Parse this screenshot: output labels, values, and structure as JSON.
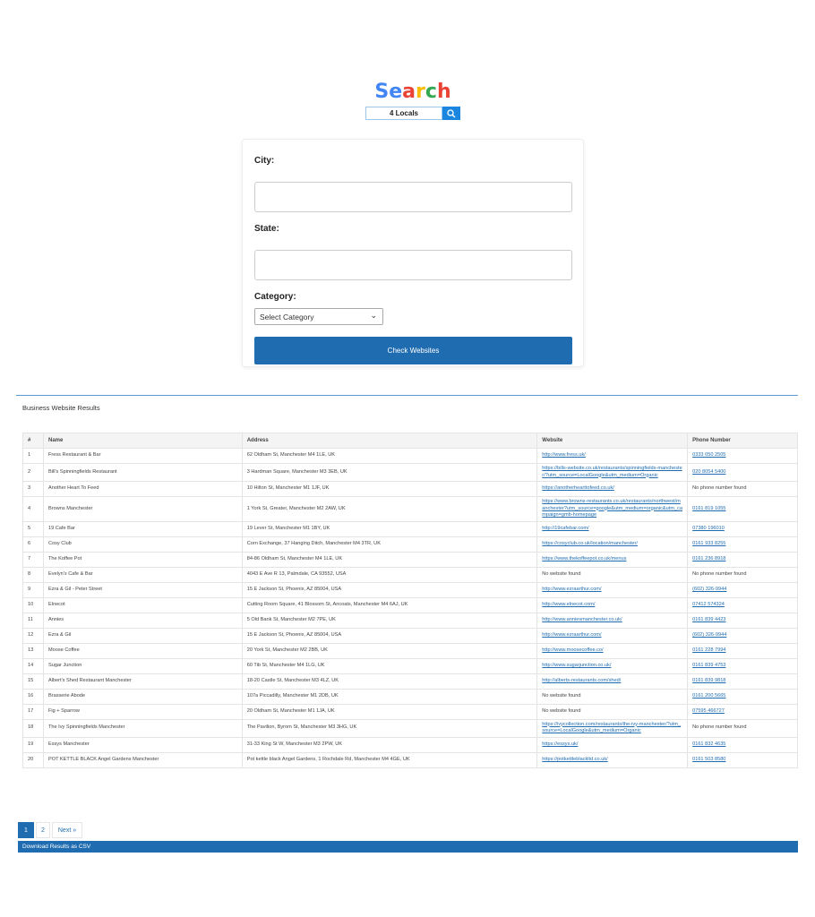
{
  "header": {
    "title_letters": [
      "S",
      "e",
      "a",
      "r",
      "c",
      "h"
    ],
    "title_colors": [
      "#4285f4",
      "#4285f4",
      "#ea4335",
      "#fbbc05",
      "#34a853",
      "#ea4335"
    ],
    "search_value": "4 Locals",
    "search_icon": "search-icon"
  },
  "form": {
    "city_label": "City:",
    "city_value": "",
    "state_label": "State:",
    "state_value": "",
    "category_label": "Category:",
    "category_selected": "Select Category",
    "submit_label": "Check Websites"
  },
  "results": {
    "title": "Business Website Results",
    "columns": [
      "#",
      "Name",
      "Address",
      "Website",
      "Phone Number"
    ],
    "rows": [
      [
        "1",
        "Fress Restaurant & Bar",
        "62 Oldham St, Manchester M4 1LE, UK",
        "http://www.fress.uk/",
        "0333 050 2505"
      ],
      [
        "2",
        "Bill's Spinningfields Restaurant",
        "3 Hardman Square, Manchester M3 3EB, UK",
        "https://bills-website.co.uk/restaurants/spinningfields-manchester/?utm_source=LocalGoogle&utm_medium=Organic",
        "020 8054 5400"
      ],
      [
        "3",
        "Another Heart To Feed",
        "10 Hilton St, Manchester M1 1JF, UK",
        "https://anotherhearttofeed.co.uk/",
        "No phone number found"
      ],
      [
        "4",
        "Browns Manchester",
        "1 York St, Greater, Manchester M2 2AW, UK",
        "https://www.browns-restaurants.co.uk/restaurants/northwest/manchester?utm_source=google&utm_medium=organic&utm_campaign=gmb-homepage",
        "0161 819 1055"
      ],
      [
        "5",
        "19 Cafe Bar",
        "19 Lever St, Manchester M1 1BY, UK",
        "http://19cafebar.com/",
        "07380 196010"
      ],
      [
        "6",
        "Cosy Club",
        "Corn Exchange, 37 Hanging Ditch, Manchester M4 3TR, UK",
        "https://cosyclub.co.uk/location/manchester/",
        "0161 933 8255"
      ],
      [
        "7",
        "The Koffee Pot",
        "84-86 Oldham St, Manchester M4 1LE, UK",
        "https://www.thekoffeepot.co.uk/menus",
        "0161 236 8918"
      ],
      [
        "8",
        "Evelyn's Cafe & Bar",
        "4043 E Ave R 13, Palmdale, CA 93552, USA",
        "No website found",
        "No phone number found"
      ],
      [
        "9",
        "Ezra & Gil - Peter Street",
        "15 E Jackson St, Phoenix, AZ 85004, USA",
        "http://www.ezraarthur.com/",
        "(602) 326-9944"
      ],
      [
        "10",
        "Elnecot",
        "Cutting Room Square, 41 Blossom St, Ancoats, Manchester M4 6AJ, UK",
        "http://www.elnecot.com/",
        "07412 574324"
      ],
      [
        "11",
        "Annies",
        "5 Old Bank St, Manchester M2 7PE, UK",
        "http://www.anniesmanchester.co.uk/",
        "0161 839 4423"
      ],
      [
        "12",
        "Ezra & Gil",
        "15 E Jackson St, Phoenix, AZ 85004, USA",
        "http://www.ezraarthur.com/",
        "(602) 326-9944"
      ],
      [
        "13",
        "Moose Coffee",
        "20 York St, Manchester M2 2BB, UK",
        "http://www.moosecoffee.co/",
        "0161 228 7994"
      ],
      [
        "14",
        "Sugar Junction",
        "60 Tib St, Manchester M4 1LG, UK",
        "http://www.sugarjunction.co.uk/",
        "0161 839 4753"
      ],
      [
        "15",
        "Albert's Shed Restaurant Manchester",
        "18-20 Castle St, Manchester M3 4LZ, UK",
        "http://alberts-restaurants.com/shed/",
        "0161 839 9818"
      ],
      [
        "16",
        "Brasserie Abode",
        "107a Piccadilly, Manchester M1 2DB, UK",
        "No website found",
        "0161 200 5665"
      ],
      [
        "17",
        "Fig + Sparrow",
        "20 Oldham St, Manchester M1 1JA, UK",
        "No website found",
        "07595 466727"
      ],
      [
        "18",
        "The Ivy Spinningfields Manchester",
        "The Pavilion, Byrom St, Manchester M3 3HG, UK",
        "https://ivycollection.com/restaurants/the-ivy-manchester/?utm_source=LocalGoogle&utm_medium=Organic",
        "No phone number found"
      ],
      [
        "19",
        "Essys Manchester",
        "31-33 King St W, Manchester M3 2PW, UK",
        "https://essys.uk/",
        "0161 832 4635"
      ],
      [
        "20",
        "POT KETTLE BLACK Angel Gardens Manchester",
        "Pot kettle black Angel Gardens, 1 Rochdale Rd, Manchester M4 4GE, UK",
        "https://potkettleblackltd.co.uk/",
        "0161 503 8580"
      ]
    ]
  },
  "pagination": {
    "pages": [
      "1",
      "2"
    ],
    "current": "1",
    "next_label": "Next »"
  },
  "download_label": "Download Results as CSV",
  "accent": "#1f6cb0"
}
